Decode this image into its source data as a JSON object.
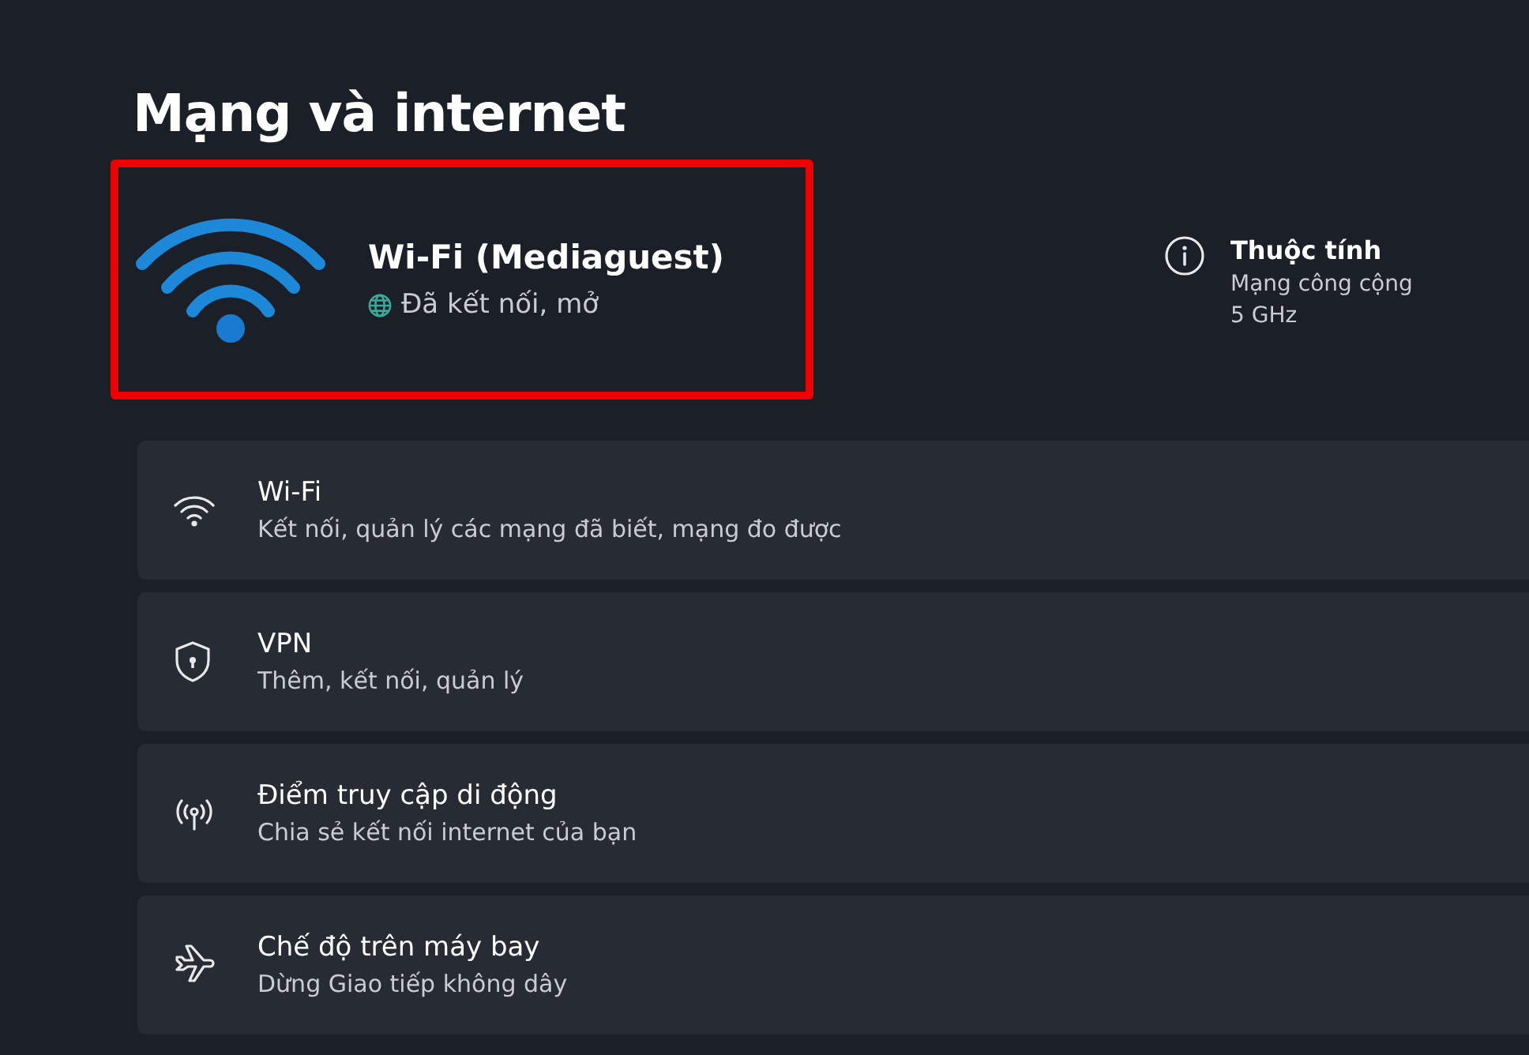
{
  "page_title": "Mạng và internet",
  "connection": {
    "name": "Wi-Fi (Mediaguest)",
    "status": "Đã kết nối, mở",
    "highlighted": true
  },
  "properties": {
    "title": "Thuộc tính",
    "lines": [
      "Mạng công cộng",
      "5 GHz"
    ]
  },
  "settings": [
    {
      "kind": "wifi",
      "title": "Wi-Fi",
      "subtitle": "Kết nối, quản lý các mạng đã biết, mạng đo được"
    },
    {
      "kind": "vpn",
      "title": "VPN",
      "subtitle": "Thêm, kết nối, quản lý"
    },
    {
      "kind": "hotspot",
      "title": "Điểm truy cập di động",
      "subtitle": "Chia sẻ kết nối internet của bạn"
    },
    {
      "kind": "airplane",
      "title": "Chế độ trên máy bay",
      "subtitle": "Dừng Giao tiếp không dây"
    }
  ]
}
